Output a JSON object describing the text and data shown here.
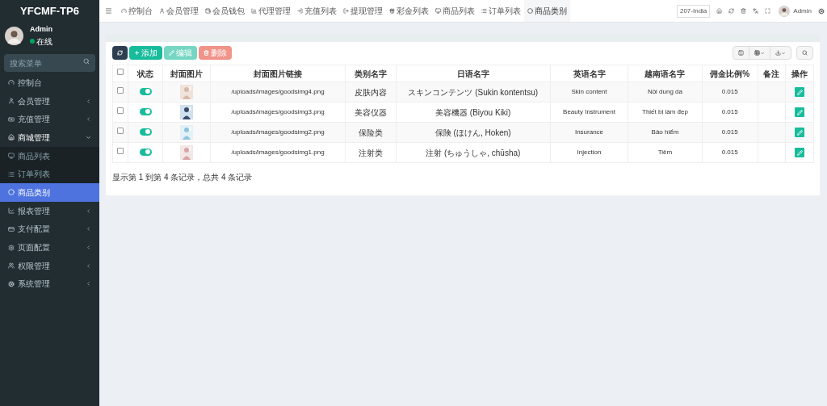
{
  "brand": "YFCMF-TP6",
  "user": {
    "name": "Admin",
    "status": "在线"
  },
  "sidebar_search": {
    "placeholder": "搜索菜单"
  },
  "sidebar": [
    {
      "label": "控制台",
      "expandable": false,
      "expanded": false,
      "selected": false
    },
    {
      "label": "会员管理",
      "expandable": true,
      "expanded": false,
      "selected": false
    },
    {
      "label": "充值管理",
      "expandable": true,
      "expanded": false,
      "selected": false
    },
    {
      "label": "商城管理",
      "expandable": true,
      "expanded": true,
      "selected": false,
      "children": [
        {
          "label": "商品列表",
          "selected": false
        },
        {
          "label": "订单列表",
          "selected": false
        },
        {
          "label": "商品类别",
          "selected": true
        }
      ]
    },
    {
      "label": "报表管理",
      "expandable": true,
      "expanded": false,
      "selected": false
    },
    {
      "label": "支付配置",
      "expandable": true,
      "expanded": false,
      "selected": false
    },
    {
      "label": "页面配置",
      "expandable": true,
      "expanded": false,
      "selected": false
    },
    {
      "label": "权限管理",
      "expandable": true,
      "expanded": false,
      "selected": false
    },
    {
      "label": "系统管理",
      "expandable": true,
      "expanded": false,
      "selected": false
    }
  ],
  "tabs": [
    {
      "label": "控制台",
      "selected": false
    },
    {
      "label": "会员管理",
      "selected": false
    },
    {
      "label": "会员钱包",
      "selected": false
    },
    {
      "label": "代理管理",
      "selected": false
    },
    {
      "label": "充值列表",
      "selected": false
    },
    {
      "label": "提现管理",
      "selected": false
    },
    {
      "label": "彩金列表",
      "selected": false
    },
    {
      "label": "商品列表",
      "selected": false
    },
    {
      "label": "订单列表",
      "selected": false
    },
    {
      "label": "商品类别",
      "selected": true
    }
  ],
  "top_right": {
    "region": "207-India",
    "user": "Admin"
  },
  "toolbar": [
    {
      "kind": "refresh",
      "disabled": false
    },
    {
      "label": "添加",
      "kind": "add",
      "disabled": false
    },
    {
      "label": "编辑",
      "kind": "edit",
      "disabled": true
    },
    {
      "label": "删除",
      "kind": "delete",
      "disabled": true
    }
  ],
  "table": {
    "select_all": false,
    "columns": [
      "状态",
      "封面图片",
      "封面图片链接",
      "类别名字",
      "日语名字",
      "英语名字",
      "越南语名字",
      "佣金比例%",
      "备注",
      "操作"
    ],
    "rows": [
      {
        "checked": false,
        "on": true,
        "link": "/uploads/images/goodsimg4.png",
        "category": "皮肤内容",
        "japanese": "スキンコンテンツ (Sukin kontentsu)",
        "english": "Skin content",
        "vietnamese": "Nội dung da",
        "commission": "0.015"
      },
      {
        "checked": false,
        "on": true,
        "link": "/uploads/images/goodsimg3.png",
        "category": "美容仪器",
        "japanese": "美容機器 (Biyou Kiki)",
        "english": "Beauty Instrument",
        "vietnamese": "Thiết bị làm đẹp",
        "commission": "0.015"
      },
      {
        "checked": false,
        "on": true,
        "link": "/uploads/images/goodsimg2.png",
        "category": "保险类",
        "japanese": "保険 (ほけん, Hoken)",
        "english": "Insurance",
        "vietnamese": "Bảo hiểm",
        "commission": "0.015"
      },
      {
        "checked": false,
        "on": true,
        "link": "/uploads/images/goodsimg1.png",
        "category": "注射类",
        "japanese": "注射 (ちゅうしゃ, chūsha)",
        "english": "Injection",
        "vietnamese": "Tiêm",
        "commission": "0.015"
      }
    ]
  },
  "pagination": "显示第 1 到第 4 条记录，总共 4 条记录"
}
